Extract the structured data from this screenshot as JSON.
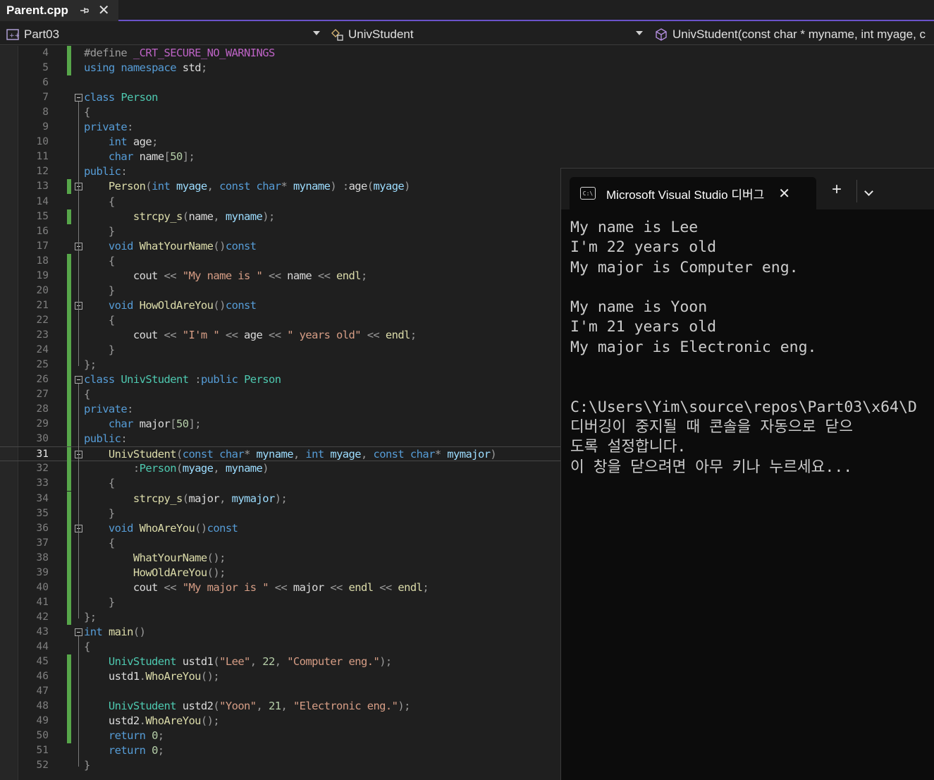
{
  "tab": {
    "title": "Parent.cpp",
    "pin_icon": "pin-icon",
    "close_icon": "close-icon"
  },
  "nav": {
    "project": "Part03",
    "scope_class": "UnivStudent",
    "member": "UnivStudent(const char * myname, int myage, c"
  },
  "editor": {
    "current_line": 31,
    "lines": [
      {
        "n": "4",
        "code": [
          [
            "pp",
            "#define "
          ],
          [
            "m",
            "_CRT_SECURE_NO_WARNINGS"
          ]
        ]
      },
      {
        "n": "5",
        "code": [
          [
            "k",
            "using "
          ],
          [
            "k",
            "namespace "
          ],
          [
            "mem",
            "std"
          ],
          [
            "p",
            ";"
          ]
        ]
      },
      {
        "n": "6",
        "code": []
      },
      {
        "n": "7",
        "code": [
          [
            "k",
            "class "
          ],
          [
            "t",
            "Person"
          ]
        ]
      },
      {
        "n": "8",
        "code": [
          [
            "p",
            "{"
          ]
        ]
      },
      {
        "n": "9",
        "code": [
          [
            "k",
            "private"
          ],
          [
            "p",
            ":"
          ]
        ]
      },
      {
        "n": "10",
        "code": [
          [
            "k",
            "    int "
          ],
          [
            "mem",
            "age"
          ],
          [
            "p",
            ";"
          ]
        ]
      },
      {
        "n": "11",
        "code": [
          [
            "k",
            "    char "
          ],
          [
            "mem",
            "name"
          ],
          [
            "p",
            "["
          ],
          [
            "n",
            "50"
          ],
          [
            "p",
            "];"
          ]
        ]
      },
      {
        "n": "12",
        "code": [
          [
            "k",
            "public"
          ],
          [
            "p",
            ":"
          ]
        ]
      },
      {
        "n": "13",
        "code": [
          [
            "f",
            "    Person"
          ],
          [
            "p",
            "("
          ],
          [
            "k",
            "int "
          ],
          [
            "var",
            "myage"
          ],
          [
            "p",
            ", "
          ],
          [
            "k",
            "const "
          ],
          [
            "k",
            "char"
          ],
          [
            "p",
            "* "
          ],
          [
            "var",
            "myname"
          ],
          [
            "p",
            ") :"
          ],
          [
            "mem",
            "age"
          ],
          [
            "p",
            "("
          ],
          [
            "var",
            "myage"
          ],
          [
            "p",
            ")"
          ]
        ]
      },
      {
        "n": "14",
        "code": [
          [
            "p",
            "    {"
          ]
        ]
      },
      {
        "n": "15",
        "code": [
          [
            "f",
            "        strcpy_s"
          ],
          [
            "p",
            "("
          ],
          [
            "mem",
            "name"
          ],
          [
            "p",
            ", "
          ],
          [
            "var",
            "myname"
          ],
          [
            "p",
            ");"
          ]
        ]
      },
      {
        "n": "16",
        "code": [
          [
            "p",
            "    }"
          ]
        ]
      },
      {
        "n": "17",
        "code": [
          [
            "k",
            "    void "
          ],
          [
            "f",
            "WhatYourName"
          ],
          [
            "p",
            "()"
          ],
          [
            "k",
            "const"
          ]
        ]
      },
      {
        "n": "18",
        "code": [
          [
            "p",
            "    {"
          ]
        ]
      },
      {
        "n": "19",
        "code": [
          [
            "mem",
            "        cout "
          ],
          [
            "p",
            "<< "
          ],
          [
            "s",
            "\"My name is \" "
          ],
          [
            "p",
            "<< "
          ],
          [
            "mem",
            "name "
          ],
          [
            "p",
            "<< "
          ],
          [
            "f",
            "endl"
          ],
          [
            "p",
            ";"
          ]
        ]
      },
      {
        "n": "20",
        "code": [
          [
            "p",
            "    }"
          ]
        ]
      },
      {
        "n": "21",
        "code": [
          [
            "k",
            "    void "
          ],
          [
            "f",
            "HowOldAreYou"
          ],
          [
            "p",
            "()"
          ],
          [
            "k",
            "const"
          ]
        ]
      },
      {
        "n": "22",
        "code": [
          [
            "p",
            "    {"
          ]
        ]
      },
      {
        "n": "23",
        "code": [
          [
            "mem",
            "        cout "
          ],
          [
            "p",
            "<< "
          ],
          [
            "s",
            "\"I'm \" "
          ],
          [
            "p",
            "<< "
          ],
          [
            "mem",
            "age "
          ],
          [
            "p",
            "<< "
          ],
          [
            "s",
            "\" years old\" "
          ],
          [
            "p",
            "<< "
          ],
          [
            "f",
            "endl"
          ],
          [
            "p",
            ";"
          ]
        ]
      },
      {
        "n": "24",
        "code": [
          [
            "p",
            "    }"
          ]
        ]
      },
      {
        "n": "25",
        "code": [
          [
            "p",
            "};"
          ]
        ]
      },
      {
        "n": "26",
        "code": [
          [
            "k",
            "class "
          ],
          [
            "t",
            "UnivStudent "
          ],
          [
            "p",
            ":"
          ],
          [
            "k",
            "public "
          ],
          [
            "t",
            "Person"
          ]
        ]
      },
      {
        "n": "27",
        "code": [
          [
            "p",
            "{"
          ]
        ]
      },
      {
        "n": "28",
        "code": [
          [
            "k",
            "private"
          ],
          [
            "p",
            ":"
          ]
        ]
      },
      {
        "n": "29",
        "code": [
          [
            "k",
            "    char "
          ],
          [
            "mem",
            "major"
          ],
          [
            "p",
            "["
          ],
          [
            "n",
            "50"
          ],
          [
            "p",
            "];"
          ]
        ]
      },
      {
        "n": "30",
        "code": [
          [
            "k",
            "public"
          ],
          [
            "p",
            ":"
          ]
        ]
      },
      {
        "n": "31",
        "code": [
          [
            "f",
            "    UnivStudent"
          ],
          [
            "p",
            "("
          ],
          [
            "k",
            "const "
          ],
          [
            "k",
            "char"
          ],
          [
            "p",
            "* "
          ],
          [
            "var",
            "myname"
          ],
          [
            "p",
            ", "
          ],
          [
            "k",
            "int "
          ],
          [
            "var",
            "myage"
          ],
          [
            "p",
            ", "
          ],
          [
            "k",
            "const "
          ],
          [
            "k",
            "char"
          ],
          [
            "p",
            "* "
          ],
          [
            "var",
            "mymajor"
          ],
          [
            "p",
            ")"
          ]
        ]
      },
      {
        "n": "32",
        "code": [
          [
            "p",
            "        :"
          ],
          [
            "t",
            "Person"
          ],
          [
            "p",
            "("
          ],
          [
            "var",
            "myage"
          ],
          [
            "p",
            ", "
          ],
          [
            "var",
            "myname"
          ],
          [
            "p",
            ")"
          ]
        ]
      },
      {
        "n": "33",
        "code": [
          [
            "p",
            "    {"
          ]
        ]
      },
      {
        "n": "34",
        "code": [
          [
            "f",
            "        strcpy_s"
          ],
          [
            "p",
            "("
          ],
          [
            "mem",
            "major"
          ],
          [
            "p",
            ", "
          ],
          [
            "var",
            "mymajor"
          ],
          [
            "p",
            ");"
          ]
        ]
      },
      {
        "n": "35",
        "code": [
          [
            "p",
            "    }"
          ]
        ]
      },
      {
        "n": "36",
        "code": [
          [
            "k",
            "    void "
          ],
          [
            "f",
            "WhoAreYou"
          ],
          [
            "p",
            "()"
          ],
          [
            "k",
            "const"
          ]
        ]
      },
      {
        "n": "37",
        "code": [
          [
            "p",
            "    {"
          ]
        ]
      },
      {
        "n": "38",
        "code": [
          [
            "f",
            "        WhatYourName"
          ],
          [
            "p",
            "();"
          ]
        ]
      },
      {
        "n": "39",
        "code": [
          [
            "f",
            "        HowOldAreYou"
          ],
          [
            "p",
            "();"
          ]
        ]
      },
      {
        "n": "40",
        "code": [
          [
            "mem",
            "        cout "
          ],
          [
            "p",
            "<< "
          ],
          [
            "s",
            "\"My major is \" "
          ],
          [
            "p",
            "<< "
          ],
          [
            "mem",
            "major "
          ],
          [
            "p",
            "<< "
          ],
          [
            "f",
            "endl "
          ],
          [
            "p",
            "<< "
          ],
          [
            "f",
            "endl"
          ],
          [
            "p",
            ";"
          ]
        ]
      },
      {
        "n": "41",
        "code": [
          [
            "p",
            "    }"
          ]
        ]
      },
      {
        "n": "42",
        "code": [
          [
            "p",
            "};"
          ]
        ]
      },
      {
        "n": "43",
        "code": [
          [
            "k",
            "int "
          ],
          [
            "f",
            "main"
          ],
          [
            "p",
            "()"
          ]
        ]
      },
      {
        "n": "44",
        "code": [
          [
            "p",
            "{"
          ]
        ]
      },
      {
        "n": "45",
        "code": [
          [
            "t",
            "    UnivStudent "
          ],
          [
            "mem",
            "ustd1"
          ],
          [
            "p",
            "("
          ],
          [
            "s",
            "\"Lee\""
          ],
          [
            "p",
            ", "
          ],
          [
            "n",
            "22"
          ],
          [
            "p",
            ", "
          ],
          [
            "s",
            "\"Computer eng.\""
          ],
          [
            "p",
            ");"
          ]
        ]
      },
      {
        "n": "46",
        "code": [
          [
            "mem",
            "    ustd1"
          ],
          [
            "p",
            "."
          ],
          [
            "f",
            "WhoAreYou"
          ],
          [
            "p",
            "();"
          ]
        ]
      },
      {
        "n": "47",
        "code": []
      },
      {
        "n": "48",
        "code": [
          [
            "t",
            "    UnivStudent "
          ],
          [
            "mem",
            "ustd2"
          ],
          [
            "p",
            "("
          ],
          [
            "s",
            "\"Yoon\""
          ],
          [
            "p",
            ", "
          ],
          [
            "n",
            "21"
          ],
          [
            "p",
            ", "
          ],
          [
            "s",
            "\"Electronic eng.\""
          ],
          [
            "p",
            ");"
          ]
        ]
      },
      {
        "n": "49",
        "code": [
          [
            "mem",
            "    ustd2"
          ],
          [
            "p",
            "."
          ],
          [
            "f",
            "WhoAreYou"
          ],
          [
            "p",
            "();"
          ]
        ]
      },
      {
        "n": "50",
        "code": [
          [
            "k",
            "    return "
          ],
          [
            "n",
            "0"
          ],
          [
            "p",
            ";"
          ]
        ]
      },
      {
        "n": "51",
        "code": [
          [
            "k",
            "    return "
          ],
          [
            "n",
            "0"
          ],
          [
            "p",
            ";"
          ]
        ]
      },
      {
        "n": "52",
        "code": [
          [
            "p",
            "}"
          ]
        ]
      }
    ]
  },
  "console": {
    "title": "Microsoft Visual Studio 디버그",
    "icon": "terminal-icon",
    "new_tab_label": "+",
    "output": "My name is Lee\nI'm 22 years old\nMy major is Computer eng.\n\nMy name is Yoon\nI'm 21 years old\nMy major is Electronic eng.\n\n\nC:\\Users\\Yim\\source\\repos\\Part03\\x64\\D\n디버깅이 중지될 때 콘솔을 자동으로 닫으\n도록 설정합니다.\n이 창을 닫으려면 아무 키나 누르세요..."
  },
  "colors": {
    "accent": "#6a53c9",
    "change_bar": "#57a64a",
    "keyword": "#569cd6",
    "type": "#4ec9b0",
    "function": "#dcdcaa",
    "string": "#d69d85",
    "number": "#b5cea8",
    "macro": "#bd63c5"
  }
}
